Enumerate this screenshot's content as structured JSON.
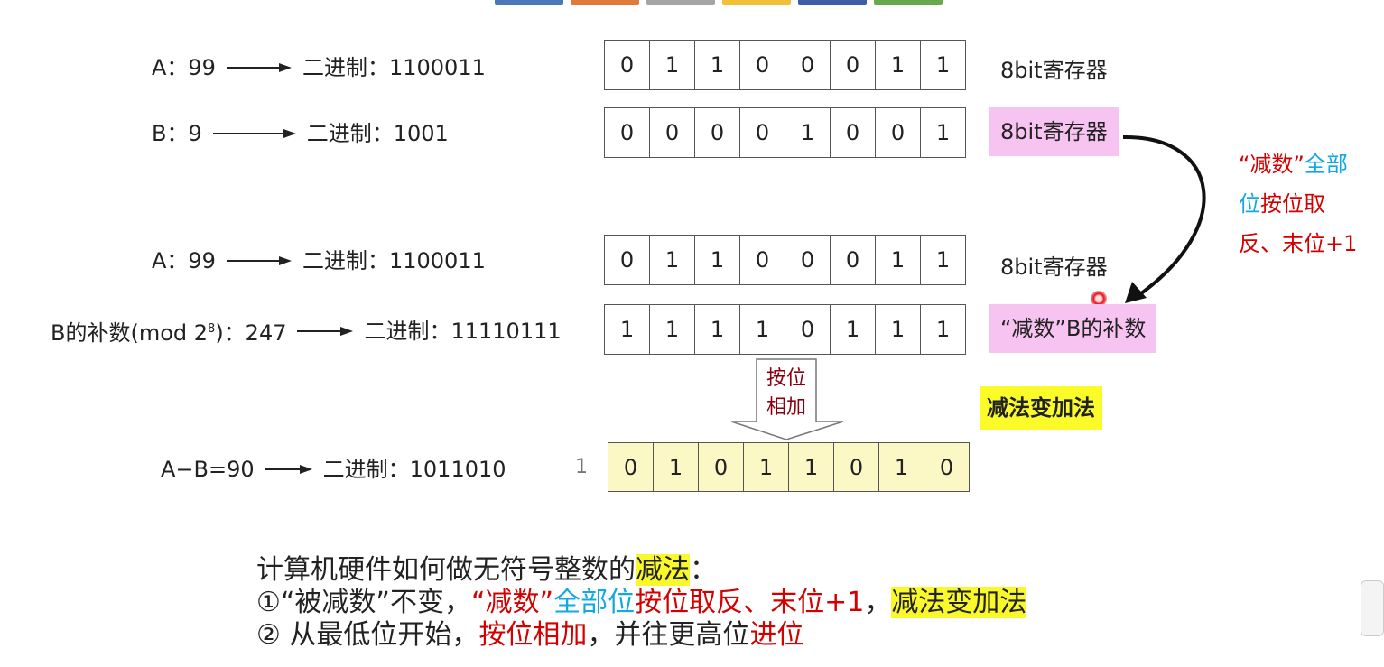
{
  "rows": [
    {
      "label": "A：99",
      "binary": "二进制：1100011",
      "bits": [
        "0",
        "1",
        "1",
        "0",
        "0",
        "0",
        "1",
        "1"
      ],
      "register": "8bit寄存器"
    },
    {
      "label": "B：9",
      "binary": "二进制：1001",
      "bits": [
        "0",
        "0",
        "0",
        "0",
        "1",
        "0",
        "0",
        "1"
      ],
      "register": "8bit寄存器"
    },
    {
      "label": "A：99",
      "binary": "二进制：1100011",
      "bits": [
        "0",
        "1",
        "1",
        "0",
        "0",
        "0",
        "1",
        "1"
      ],
      "register": "8bit寄存器"
    },
    {
      "label_prefix": "B的补数(mod 2",
      "label_sup": "8",
      "label_suffix": ")：247",
      "binary": "二进制：11110111",
      "bits": [
        "1",
        "1",
        "1",
        "1",
        "0",
        "1",
        "1",
        "1"
      ],
      "register": "“减数”B的补数"
    }
  ],
  "result": {
    "label": "A−B=90",
    "binary": "二进制：1011010",
    "carry": "1",
    "bits": [
      "0",
      "1",
      "0",
      "1",
      "1",
      "0",
      "1",
      "0"
    ]
  },
  "add_label_line1": "按位",
  "add_label_line2": "相加",
  "sub_to_add": "减法变加法",
  "note": {
    "part1": "“减数”",
    "part2": "全部",
    "part3": "位",
    "part4": "按位取",
    "part5": "反、末位+1"
  },
  "bottom": {
    "line1_prefix": "计算机硬件如何做无符号整数的",
    "line1_hl": "减法",
    "line1_suffix": "：",
    "line2_a": "①“被减数”不变，",
    "line2_b": "“减数”",
    "line2_c": "全部位",
    "line2_d": "按位取反、末位+1",
    "line2_e": "，",
    "line2_f": "减法变加法",
    "line3_a": "② 从最低位开始，",
    "line3_b": "按位相加",
    "line3_c": "，并往更高位",
    "line3_d": "进位"
  },
  "colors": {
    "pink": "#f7c4f2",
    "yellow": "#fbfb2a",
    "result_bg": "#fbf8c6",
    "red": "#d40000",
    "cyan": "#13a8e0"
  }
}
